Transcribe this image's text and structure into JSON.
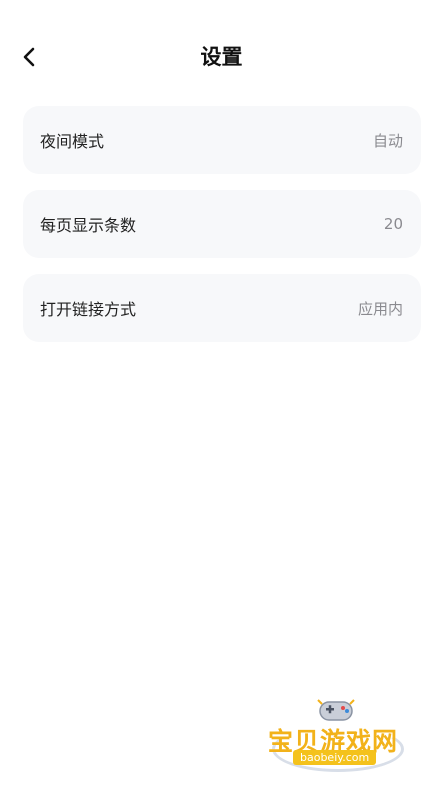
{
  "header": {
    "title": "设置",
    "back_icon": "chevron-left-icon"
  },
  "settings": [
    {
      "label": "夜间模式",
      "value": "自动"
    },
    {
      "label": "每页显示条数",
      "value": "20"
    },
    {
      "label": "打开链接方式",
      "value": "应用内"
    }
  ],
  "watermark": {
    "brand": "宝贝游戏网",
    "url": "baobeiy.com"
  },
  "colors": {
    "background": "#ffffff",
    "card": "#f7f8fa",
    "label": "#222222",
    "value": "#8a8a8f",
    "watermark_accent": "#f2b21a"
  }
}
